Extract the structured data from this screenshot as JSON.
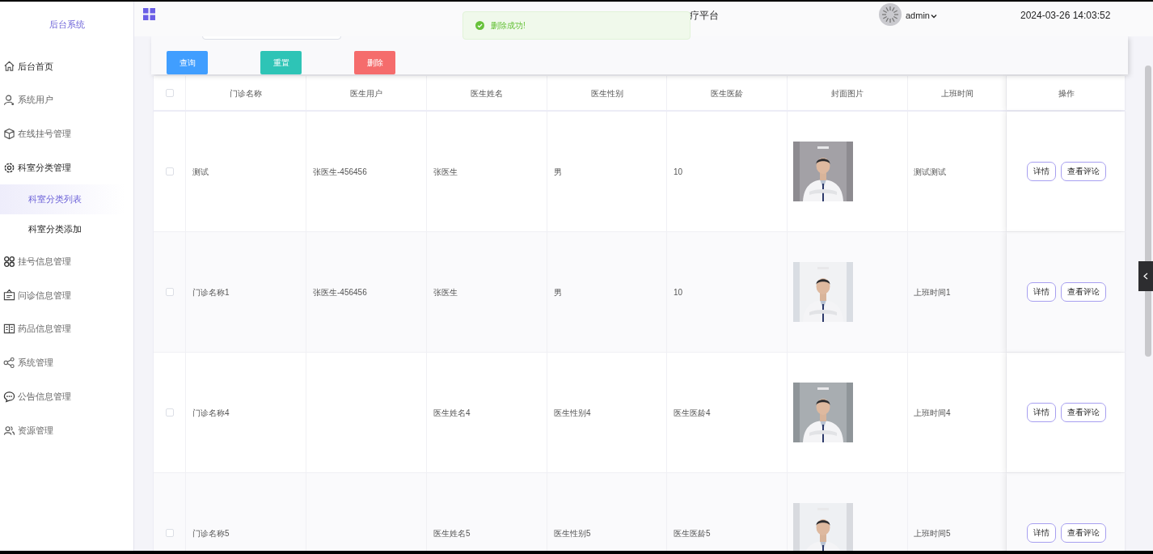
{
  "sidebar": {
    "title": "后台系统",
    "items": [
      {
        "label": "后台首页",
        "selected": false
      },
      {
        "label": "系统用户",
        "selected": false
      },
      {
        "label": "在线挂号管理",
        "selected": false
      },
      {
        "label": "科室分类管理",
        "selected": false,
        "expanded": true,
        "children": [
          {
            "label": "科室分类列表",
            "selected": true
          },
          {
            "label": "科室分类添加",
            "selected": false
          }
        ]
      },
      {
        "label": "挂号信息管理",
        "selected": false
      },
      {
        "label": "问诊信息管理",
        "selected": false
      },
      {
        "label": "药品信息管理",
        "selected": false
      },
      {
        "label": "系统管理",
        "selected": false
      },
      {
        "label": "公告信息管理",
        "selected": false
      },
      {
        "label": "资源管理",
        "selected": false
      }
    ]
  },
  "header": {
    "title": "疗平台",
    "user": "admin",
    "datetime": "2024-03-26 14:03:52"
  },
  "toast": {
    "kind": "success",
    "message": "删除成功!"
  },
  "toolbar": {
    "buttons": [
      {
        "label": "查询",
        "kind": "primary"
      },
      {
        "label": "重置",
        "kind": "reset"
      },
      {
        "label": "删除",
        "kind": "danger"
      }
    ]
  },
  "table": {
    "all_checked": false,
    "columns": [
      "门诊名称",
      "医生用户",
      "医生姓名",
      "医生性别",
      "医生医龄",
      "封面图片",
      "上班时间",
      "操作"
    ],
    "rows": [
      {
        "checked": false,
        "cells": [
          "测试",
          "张医生-456456",
          "张医生",
          "男",
          "10"
        ],
        "cover": {
          "kind": "picture"
        },
        "shift": "测试测试",
        "actions": [
          "详情",
          "查看评论"
        ]
      },
      {
        "checked": false,
        "cells": [
          "门诊名称1",
          "张医生-456456",
          "张医生",
          "男",
          "10"
        ],
        "cover": {
          "kind": "picture"
        },
        "shift": "上班时间1",
        "actions": [
          "详情",
          "查看评论"
        ]
      },
      {
        "checked": false,
        "cells": [
          "门诊名称4",
          "",
          "医生姓名4",
          "医生性别4",
          "医生医龄4"
        ],
        "cover": {
          "kind": "picture"
        },
        "shift": "上班时间4",
        "actions": [
          "详情",
          "查看评论"
        ]
      },
      {
        "checked": false,
        "cells": [
          "门诊名称5",
          "",
          "医生姓名5",
          "医生性别5",
          "医生医龄5"
        ],
        "cover": {
          "kind": "picture"
        },
        "shift": "上班时间5",
        "actions": [
          "详情",
          "查看评论"
        ]
      }
    ]
  }
}
